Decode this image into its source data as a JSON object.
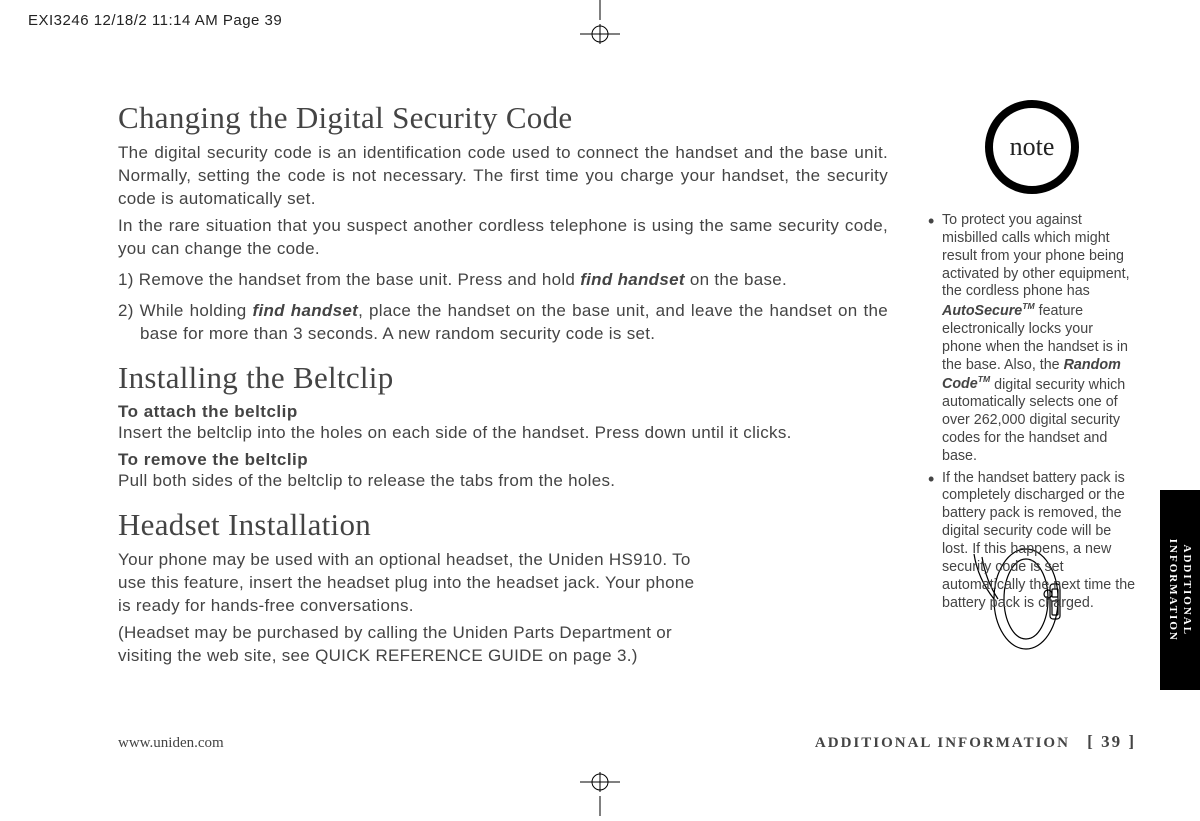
{
  "header": {
    "crop_info": "EXI3246  12/18/2 11:14 AM  Page 39"
  },
  "side_tab": {
    "line1": "ADDITIONAL",
    "line2": "INFORMATION"
  },
  "main": {
    "sec1": {
      "title": "Changing the Digital Security Code",
      "p1": "The digital security code is an identification code used to connect the handset and the base unit. Normally, setting the code is not necessary. The first time you charge your handset, the security code is automatically set.",
      "p2": "In the rare situation that you suspect another cordless telephone is using the same security code, you can change the code.",
      "step1_a": "1) Remove the handset from the base unit. Press and hold ",
      "step1_b": "find handset",
      "step1_c": " on the base.",
      "step2_a": "2) While holding ",
      "step2_b": "find handset",
      "step2_c": ", place the handset on the base unit, and leave the handset on the base for more than 3 seconds. A new random security code is set."
    },
    "sec2": {
      "title": "Installing the Beltclip",
      "sub1": "To attach the beltclip",
      "p1": "Insert the beltclip into the holes on each side of the handset. Press down until it clicks.",
      "sub2": "To remove the beltclip",
      "p2": "Pull both sides of the beltclip to release the tabs from the holes."
    },
    "sec3": {
      "title": "Headset Installation",
      "p1": "Your phone may be used with an optional headset, the Uniden HS910. To use this feature, insert the headset plug into the headset jack. Your phone is ready for hands-free conversations.",
      "p2": "(Headset may be purchased by calling the Uniden Parts Department or visiting the web site, see QUICK REFERENCE GUIDE on page 3.)"
    }
  },
  "sidebar": {
    "note_label": "note",
    "bullets": {
      "b1_a": "To protect you against misbilled calls which might result from your phone being activated by other equipment, the cordless phone has ",
      "b1_b": "AutoSecure",
      "b1_c": " feature electronically locks your phone when the handset is in the base. Also, the ",
      "b1_d": "Random Code",
      "b1_e": " digital security which automatically selects one of over 262,000 digital security codes for the handset and base.",
      "b2": "If the handset battery pack is completely discharged or the battery pack is removed, the digital security code will be lost. If this happens, a new security code is set automatically the next time the battery pack is charged."
    }
  },
  "footer": {
    "url": "www.uniden.com",
    "section": "ADDITIONAL INFORMATION",
    "page": "[ 39 ]"
  }
}
